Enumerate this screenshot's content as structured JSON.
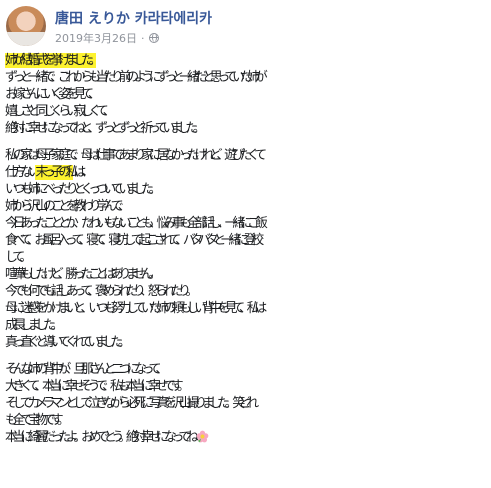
{
  "author": {
    "name": "唐田 えりか 카라타에리카",
    "date": "2019年3月26日",
    "dot": "·"
  },
  "paragraphs": [
    [
      [
        "姉が結婚式を挙げました。"
      ],
      [
        "ずっと一緒で、これからも当たり前のようにずっと一緒だと思っていた姉が"
      ],
      [
        "お嫁さんにいく姿を見て、"
      ],
      [
        "嬉しさと同じくらい寂しくて、"
      ],
      [
        "絶対に幸せになってねと、ずっとずっと祈っていました。"
      ]
    ],
    [
      [
        "私の家は母子家庭で、母は仕事であまり家に居なかったけれど、遊びたくて"
      ],
      [
        "仕方ない",
        "末っ子の私",
        "は、"
      ],
      [
        "いつも姉にべったりとくっついていました。"
      ],
      [
        "姉から沢山のことを教わり学んで、"
      ],
      [
        "今日あったこととか、たわいもないことも、悩み事も全部話し、一緒にご飯"
      ],
      [
        "食べて、お風呂入って、寝て、寝坊して起こされて、バタバタと一緒に登校"
      ],
      [
        "して。"
      ],
      [
        "喧嘩もしたけど、勝ったことはありません。"
      ],
      [
        "今でも何でも話しあって、褒められたり、怒られたり。"
      ],
      [
        "母に迷惑をかけまいと、いつも努力していた姉の頼もしい背中を見て、私は"
      ],
      [
        "成長しました。"
      ],
      [
        "真っ直ぐと導いてくれていました。"
      ]
    ],
    [
      [
        "そんな姉の背中が、旦那さんと二つになって、"
      ],
      [
        "大きくて、本当に幸せそうで、私も本当に幸せです。"
      ],
      [
        "そしてカメラマンとして泣きながら必死に写真を沢山撮りました。笑 どれ"
      ],
      [
        "も全て宝物です。"
      ],
      [
        "本当に綺麗だったよ。おめでとう。絶対幸せになってね"
      ]
    ]
  ],
  "icons": {
    "privacy": "globe-icon",
    "end_emoji": "blossom-emoji"
  },
  "colors": {
    "name": "#385898",
    "highlight": "#fdf22f",
    "meta": "#90949c",
    "text": "#1c1e21"
  }
}
